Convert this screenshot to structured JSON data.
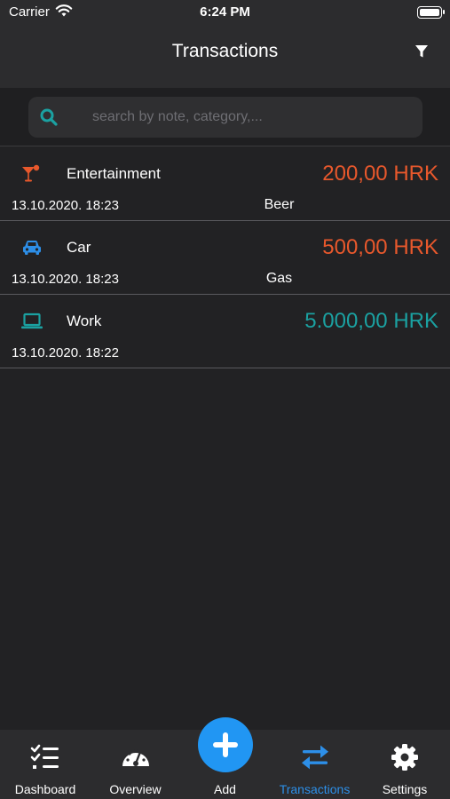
{
  "status_bar": {
    "carrier": "Carrier",
    "time": "6:24 PM"
  },
  "header": {
    "title": "Transactions"
  },
  "search": {
    "placeholder": "search by note, category,..."
  },
  "transactions": [
    {
      "category": "Entertainment",
      "amount": "200,00 HRK",
      "date": "13.10.2020. 18:23",
      "note": "Beer",
      "icon": "cocktail-icon",
      "type": "expense"
    },
    {
      "category": "Car",
      "amount": "500,00 HRK",
      "date": "13.10.2020. 18:23",
      "note": "Gas",
      "icon": "car-icon",
      "type": "expense"
    },
    {
      "category": "Work",
      "amount": "5.000,00 HRK",
      "date": "13.10.2020. 18:22",
      "note": "",
      "icon": "laptop-icon",
      "type": "income"
    }
  ],
  "tabs": [
    {
      "label": "Dashboard",
      "icon": "checklist-icon",
      "active": false
    },
    {
      "label": "Overview",
      "icon": "speedometer-icon",
      "active": false
    },
    {
      "label": "Add",
      "icon": "plus-icon",
      "active": false
    },
    {
      "label": "Transactions",
      "icon": "swap-arrows-icon",
      "active": true
    },
    {
      "label": "Settings",
      "icon": "gear-icon",
      "active": false
    }
  ],
  "colors": {
    "expense": "#e8582c",
    "income": "#1ba1a1",
    "accent": "#2d8fe8",
    "car_icon": "#2d8fe8",
    "search_icon": "#1ba1a1"
  }
}
